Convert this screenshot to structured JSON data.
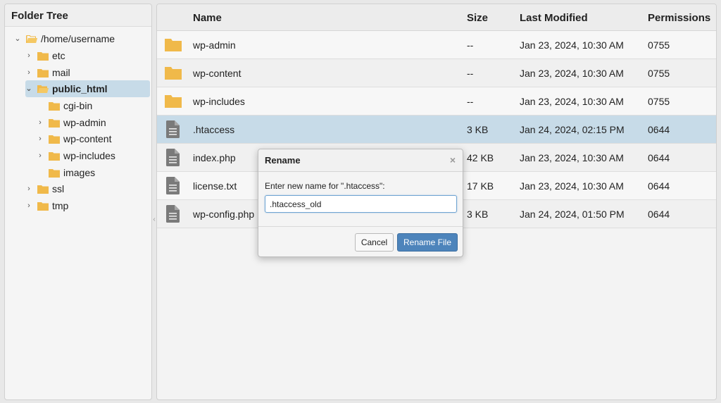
{
  "tree": {
    "title": "Folder Tree",
    "nodes": [
      {
        "label": "/home/username",
        "expanded": true
      },
      {
        "label": "etc"
      },
      {
        "label": "mail"
      },
      {
        "label": "public_html",
        "expanded": true,
        "selected": true
      },
      {
        "label": "cgi-bin"
      },
      {
        "label": "wp-admin"
      },
      {
        "label": "wp-content"
      },
      {
        "label": "wp-includes"
      },
      {
        "label": "images"
      },
      {
        "label": "ssl"
      },
      {
        "label": "tmp"
      }
    ]
  },
  "files": {
    "columns": {
      "name": "Name",
      "size": "Size",
      "modified": "Last Modified",
      "perms": "Permissions"
    },
    "rows": [
      {
        "icon": "folder-icon",
        "name": "wp-admin",
        "size": "--",
        "modified": "Jan 23, 2024, 10:30 AM",
        "perms": "0755"
      },
      {
        "icon": "folder-icon",
        "name": "wp-content",
        "size": "--",
        "modified": "Jan 23, 2024, 10:30 AM",
        "perms": "0755"
      },
      {
        "icon": "folder-icon",
        "name": "wp-includes",
        "size": "--",
        "modified": "Jan 23, 2024, 10:30 AM",
        "perms": "0755"
      },
      {
        "icon": "file-icon",
        "name": ".htaccess",
        "size": "3 KB",
        "modified": "Jan 24, 2024, 02:15 PM",
        "perms": "0644",
        "selected": true
      },
      {
        "icon": "file-icon",
        "name": "index.php",
        "size": "42 KB",
        "modified": "Jan 23, 2024, 10:30 AM",
        "perms": "0644"
      },
      {
        "icon": "file-icon",
        "name": "license.txt",
        "size": "17 KB",
        "modified": "Jan 23, 2024, 10:30 AM",
        "perms": "0644"
      },
      {
        "icon": "file-icon",
        "name": "wp-config.php",
        "size": "3 KB",
        "modified": "Jan 24, 2024, 01:50 PM",
        "perms": "0644"
      }
    ]
  },
  "dialog": {
    "title": "Rename",
    "close_glyph": "×",
    "prompt": "Enter new name for \".htaccess\":",
    "input_value": ".htaccess_old",
    "cancel_label": "Cancel",
    "confirm_label": "Rename File"
  },
  "colors": {
    "selection": "#c7dbe8",
    "folder": "#f0b94a",
    "primary_button": "#4d84bb"
  }
}
